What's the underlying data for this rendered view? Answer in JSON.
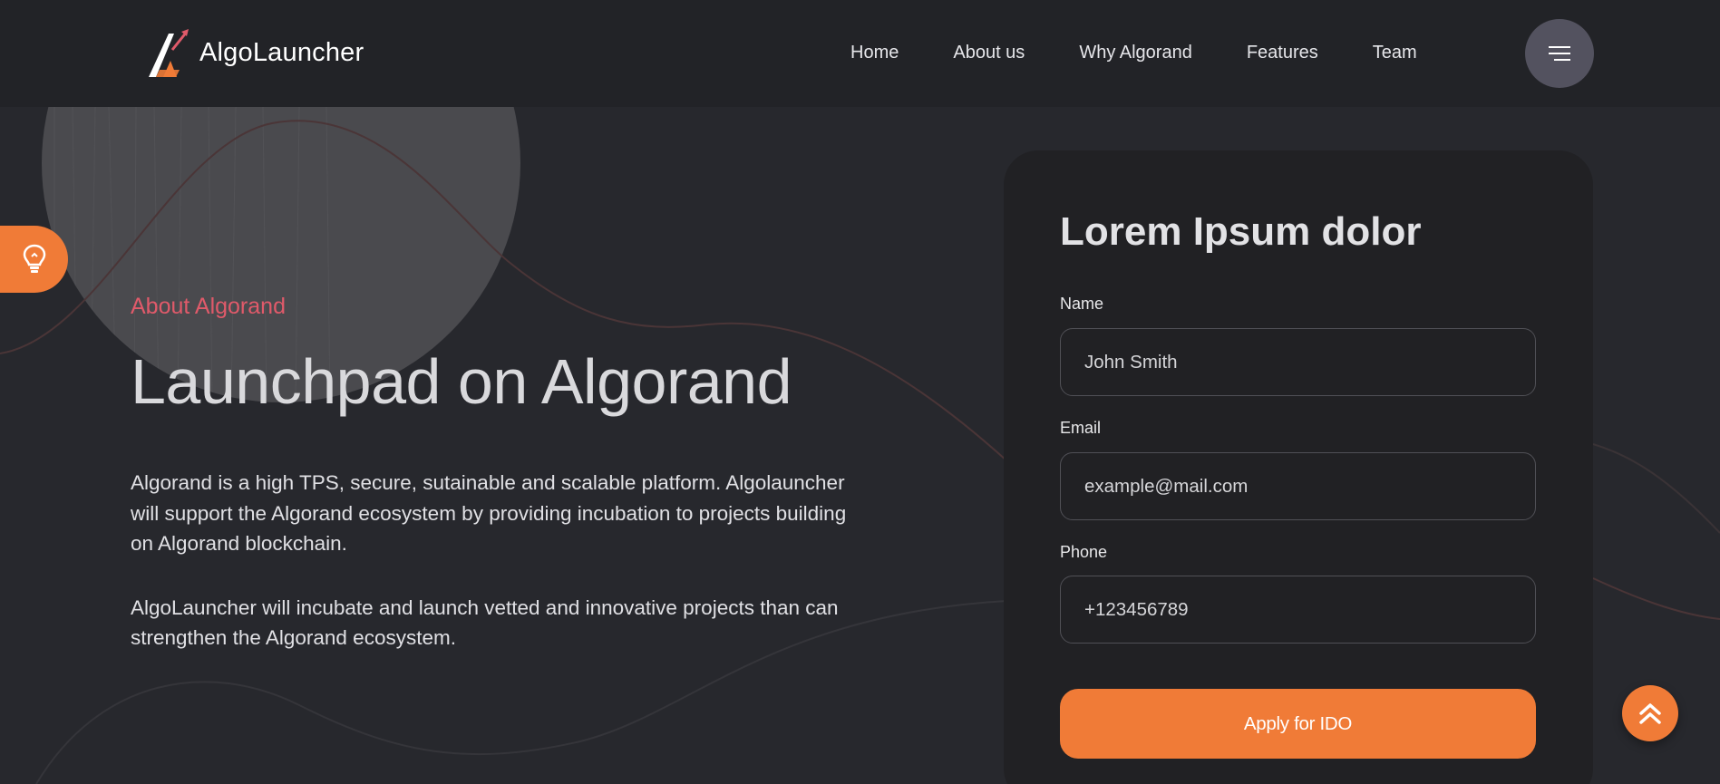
{
  "brand": {
    "name": "AlgoLauncher",
    "accent": "#f07b37",
    "eyebrow_color": "#e05a6a"
  },
  "nav": {
    "items": [
      {
        "label": "Home"
      },
      {
        "label": "About us"
      },
      {
        "label": "Why Algorand"
      },
      {
        "label": "Features"
      },
      {
        "label": "Team"
      }
    ],
    "menu_icon": "hamburger-icon"
  },
  "side_tab": {
    "icon": "lightbulb-icon"
  },
  "hero": {
    "eyebrow": "About Algorand",
    "title": "Launchpad on Algorand",
    "paragraphs": [
      "Algorand is a high TPS, secure, sutainable and scalable platform. Algolauncher will support the Algorand ecosystem by providing incubation to projects building on Algorand blockchain.",
      "AlgoLauncher will incubate and launch vetted and innovative projects than can strengthen the Algorand ecosystem."
    ]
  },
  "form": {
    "title": "Lorem Ipsum dolor",
    "fields": [
      {
        "label": "Name",
        "placeholder": "John Smith"
      },
      {
        "label": "Email",
        "placeholder": "example@mail.com"
      },
      {
        "label": "Phone",
        "placeholder": "+123456789"
      }
    ],
    "submit_label": "Apply for IDO"
  },
  "scroll_top": {
    "icon": "double-chevron-up-icon"
  }
}
